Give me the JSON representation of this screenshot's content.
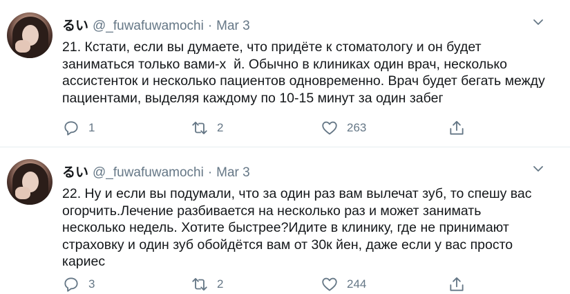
{
  "tweets": [
    {
      "display_name": "るい",
      "handle": "@_fuwafuwamochi",
      "separator": "·",
      "date": "Mar 3",
      "text": "21. Кстати, если вы думаете, что придёте к стоматологу и он будет заниматься только вами-х  й. Обычно в клиниках один врач, несколько ассистенток и несколько пациентов одновременно. Врач будет бегать между пациентами, выделяя каждому по 10-15 минут за один забег",
      "replies": "1",
      "retweets": "2",
      "likes": "263"
    },
    {
      "display_name": "るい",
      "handle": "@_fuwafuwamochi",
      "separator": "·",
      "date": "Mar 3",
      "text": "22. Ну и если вы подумали, что за один раз вам вылечат зуб, то спешу вас огорчить.Лечение разбивается на несколько раз и может занимать несколько недель. Хотите быстрее?Идите в клинику, где не принимают страховку и один зуб обойдётся вам от 30к йен, даже если у вас просто кариес",
      "replies": "3",
      "retweets": "2",
      "likes": "244"
    }
  ],
  "icons": {
    "reply": "reply-icon",
    "retweet": "retweet-icon",
    "like": "heart-icon",
    "share": "share-icon",
    "menu": "chevron-down-icon"
  },
  "colors": {
    "text": "#14171a",
    "secondary": "#657786",
    "divider": "#e6ecf0"
  }
}
